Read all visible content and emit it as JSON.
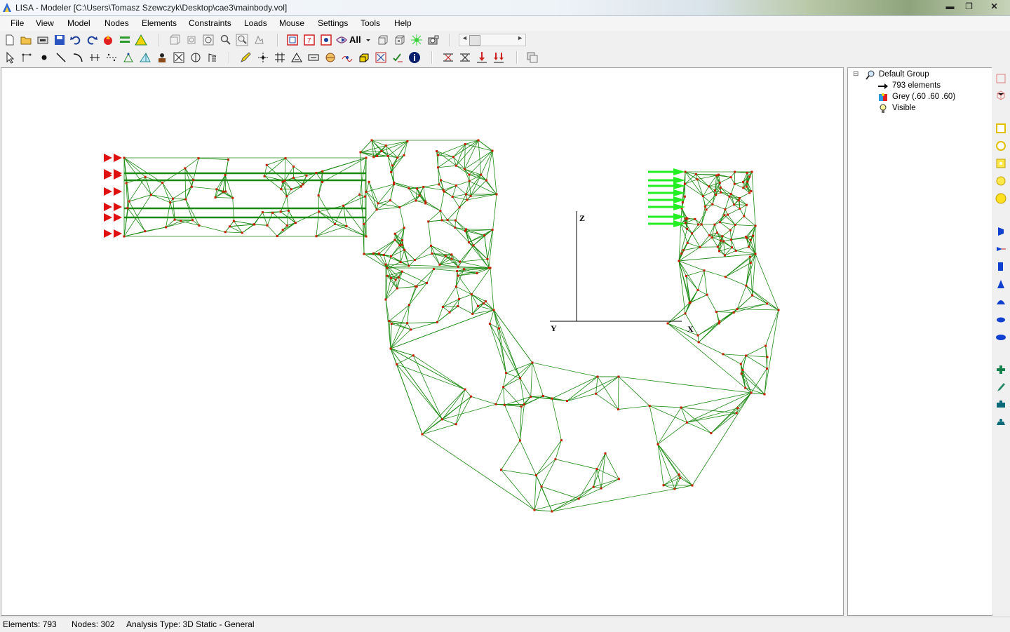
{
  "window": {
    "title": "LISA - Modeler [C:\\Users\\Tomasz Szewczyk\\Desktop\\cae3\\mainbody.vol]",
    "minimize_glyph": "▬",
    "maximize_glyph": "❐",
    "close_glyph": "✕"
  },
  "menu": [
    "File",
    "View",
    "Model",
    "Nodes",
    "Elements",
    "Constraints",
    "Loads",
    "Mouse",
    "Settings",
    "Tools",
    "Help"
  ],
  "toolbar": {
    "all_label": "All",
    "view_slider_position": 0.15
  },
  "viewport": {
    "axis_z_label": "Z",
    "axis_y_label": "Y",
    "axis_x_label": "X",
    "colors": {
      "mesh": "#1a8a12",
      "node": "#c81e00",
      "constraint": "#e01010",
      "load": "#22ee22",
      "axis": "#000000"
    }
  },
  "tree": {
    "group": "Default Group",
    "elements": "793 elements",
    "material": "Grey (.60 .60 .60)",
    "visibility": "Visible",
    "expander": "⊟"
  },
  "status": {
    "elements": "Elements:  793",
    "nodes": "Nodes: 302",
    "analysis": "Analysis Type: 3D Static - General"
  }
}
